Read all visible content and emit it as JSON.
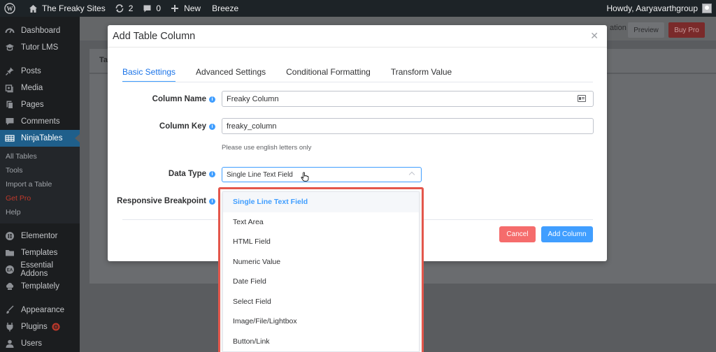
{
  "adminbar": {
    "site_name": "The Freaky Sites",
    "updates_count": "2",
    "comments_count": "0",
    "new_label": "New",
    "breeze_label": "Breeze",
    "howdy": "Howdy, Aaryavarthgroup"
  },
  "sidebar": {
    "items": [
      {
        "label": "Dashboard",
        "icon": "dashboard-icon"
      },
      {
        "label": "Tutor LMS",
        "icon": "graduation-cap-icon"
      },
      {
        "label": "Posts",
        "icon": "pin-icon"
      },
      {
        "label": "Media",
        "icon": "media-icon"
      },
      {
        "label": "Pages",
        "icon": "pages-icon"
      },
      {
        "label": "Comments",
        "icon": "comment-icon"
      },
      {
        "label": "NinjaTables",
        "icon": "table-icon"
      }
    ],
    "submenu": [
      "All Tables",
      "Tools",
      "Import a Table",
      "Get Pro",
      "Help"
    ],
    "items_lower": [
      {
        "label": "Elementor",
        "icon": "elementor-icon"
      },
      {
        "label": "Templates",
        "icon": "folder-icon"
      },
      {
        "label": "Essential Addons",
        "icon": "ea-icon"
      },
      {
        "label": "Templately",
        "icon": "templately-icon"
      },
      {
        "label": "Appearance",
        "icon": "brush-icon"
      },
      {
        "label": "Plugins",
        "icon": "plugin-icon"
      },
      {
        "label": "Users",
        "icon": "user-icon"
      }
    ]
  },
  "background": {
    "nav_fragment": "ation",
    "preview_label": "Preview",
    "buy_pro_label": "Buy Pro",
    "tab_fragment": "Ta"
  },
  "modal": {
    "title": "Add Table Column",
    "tabs": [
      "Basic Settings",
      "Advanced Settings",
      "Conditional Formatting",
      "Transform Value"
    ],
    "active_tab": "Basic Settings",
    "fields": {
      "column_name_label": "Column Name",
      "column_name_value": "Freaky Column",
      "column_key_label": "Column Key",
      "column_key_value": "freaky_column",
      "column_key_hint": "Please use english letters only",
      "data_type_label": "Data Type",
      "data_type_value": "Single Line Text Field",
      "responsive_label": "Responsive Breakpoint"
    },
    "buttons": {
      "cancel": "Cancel",
      "add": "Add Column"
    }
  },
  "dropdown": {
    "options": [
      "Single Line Text Field",
      "Text Area",
      "HTML Field",
      "Numeric Value",
      "Date Field",
      "Select Field",
      "Image/File/Lightbox",
      "Button/Link"
    ],
    "selected": "Single Line Text Field"
  },
  "colors": {
    "accent": "#409eff",
    "danger": "#f56c6c",
    "highlight_border": "#e4574c",
    "admin_bar": "#1d2327",
    "menu_active": "#1f5f8b"
  }
}
